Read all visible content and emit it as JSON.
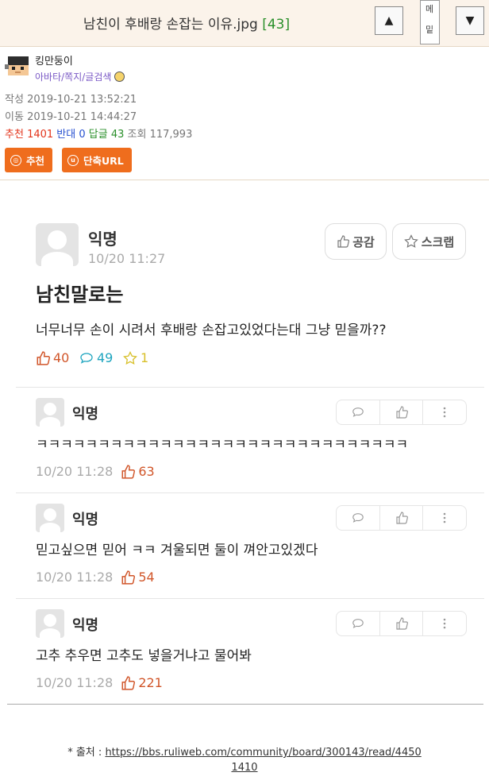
{
  "header": {
    "title": "남친이 후배랑 손잡는 이유.jpg",
    "comment_count": "[43]",
    "up_label": "▲",
    "down_label": "▼",
    "menu_top": "메",
    "menu_bottom": "밑"
  },
  "author": {
    "name": "킹만둥이",
    "links": "아바타/쪽지/글검색"
  },
  "meta": {
    "written_label": "작성",
    "written": "2019-10-21 13:52:21",
    "moved_label": "이동",
    "moved": "2019-10-21 14:44:27",
    "recommend_label": "추천",
    "recommend": "1401",
    "oppose_label": "반대",
    "oppose": "0",
    "reply_label": "답글",
    "reply": "43",
    "view_label": "조회",
    "view": "117,993"
  },
  "buttons": {
    "recommend": "추천",
    "short_url": "단축URL"
  },
  "post": {
    "author": "익명",
    "time": "10/20 11:27",
    "empathy": "공감",
    "scrap": "스크랩",
    "title": "남친말로는",
    "body": "너무너무 손이 시려서 후배랑 손잡고있었다는대 그냥 믿을까??",
    "likes": "40",
    "comments": "49",
    "stars": "1"
  },
  "comments": [
    {
      "author": "익명",
      "text": "ㅋㅋㅋㅋㅋㅋㅋㅋㅋㅋㅋㅋㅋㅋㅋㅋㅋㅋㅋㅋㅋㅋㅋㅋㅋㅋㅋㅋㅋㅋ",
      "time": "10/20 11:28",
      "likes": "63"
    },
    {
      "author": "익명",
      "text": "믿고싶으면 믿어 ㅋㅋ 겨울되면 둘이 껴안고있겠다",
      "time": "10/20 11:28",
      "likes": "54"
    },
    {
      "author": "익명",
      "text": "고추 추우면 고추도 넣을거냐고 물어봐",
      "time": "10/20 11:28",
      "likes": "221"
    }
  ],
  "source": {
    "prefix": "* 출처 :",
    "url_line1": "https://bbs.ruliweb.com/community/board/300143/read/4450",
    "url_line2": "1410"
  }
}
